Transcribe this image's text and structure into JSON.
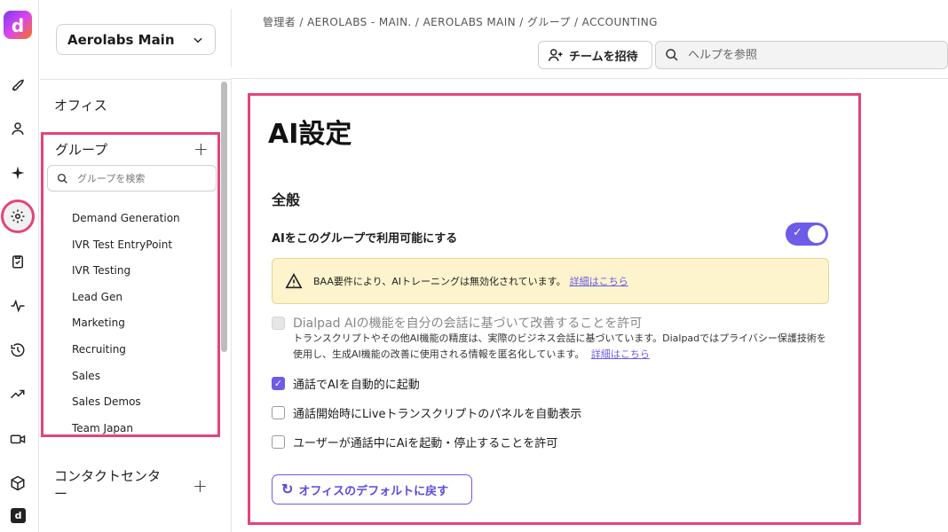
{
  "rail": {
    "logo": "d",
    "items": [
      "rocket-icon",
      "user-icon",
      "sparkle-icon",
      "settings-icon",
      "clipboard-icon",
      "activity-icon",
      "history-icon",
      "trending-icon",
      "video-icon",
      "box-icon"
    ],
    "active": "settings-icon"
  },
  "sidebar": {
    "org_select": "Aerolabs Main",
    "office_label": "オフィス",
    "groups_label": "グループ",
    "group_search_placeholder": "グループを検索",
    "groups": [
      "Demand Generation",
      "IVR Test EntryPoint",
      "IVR Testing",
      "Lead Gen",
      "Marketing",
      "Recruiting",
      "Sales",
      "Sales Demos",
      "Team Japan"
    ],
    "contact_center_label_line1": "コンタクトセンタ",
    "contact_center_label_line2": "ー"
  },
  "header": {
    "breadcrumb": "管理者 / AEROLABS - MAIN. / AEROLABS MAIN / グループ / ACCOUNTING",
    "invite_label": "チームを招待",
    "help_placeholder": "ヘルプを参照"
  },
  "main": {
    "title": "AI設定",
    "section": "全般",
    "toggle_label": "AIをこのグループで利用可能にする",
    "toggle_on": true,
    "warning_text": "BAA要件により、AIトレーニングは無効化されています。",
    "warning_link": "詳細はこちら",
    "improve_label": "Dialpad AIの機能を自分の会話に基づいて改善することを許可",
    "improve_desc": "トランスクリプトやその他AI機能の精度は、実際のビジネス会話に基づいています。Dialpadではプライバシー保護技術を使用し、生成AI機能の改善に使用される情報を匿名化しています。",
    "improve_link": "詳細はこちら",
    "auto_start_label": "通話でAIを自動的に起動",
    "live_transcript_label": "通話開始時にLiveトランスクリプトのパネルを自動表示",
    "allow_user_label": "ユーザーが通話中にAiを起動・停止することを許可",
    "reset_label": "オフィスのデフォルトに戻す"
  },
  "colors": {
    "accent": "#6c5ce7",
    "highlight": "#e2457a",
    "warning_bg": "#fdf3cc"
  }
}
